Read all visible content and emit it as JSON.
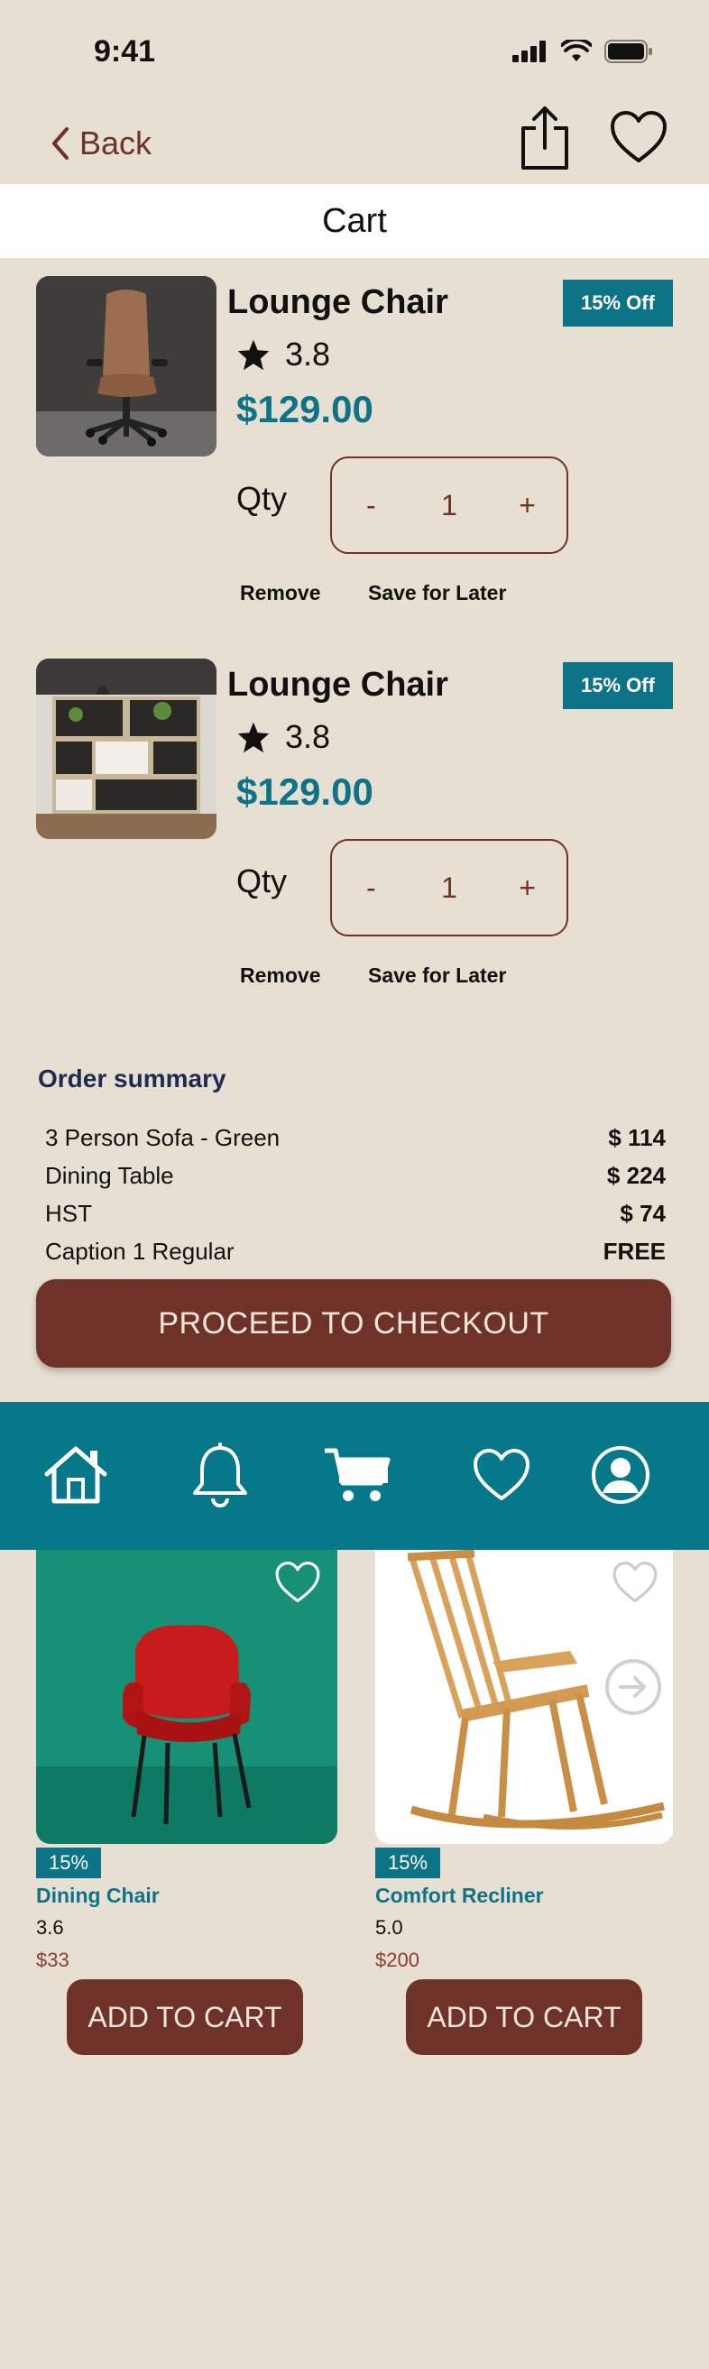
{
  "status_bar": {
    "time": "9:41"
  },
  "nav": {
    "back_label": "Back"
  },
  "header": {
    "title": "Cart"
  },
  "cart_items": [
    {
      "name": "Lounge Chair",
      "rating": "3.8",
      "price": "$129.00",
      "discount": "15% Off",
      "qty_label": "Qty",
      "qty_minus": "-",
      "qty_value": "1",
      "qty_plus": "+",
      "remove_label": "Remove",
      "save_label": "Save for Later"
    },
    {
      "name": "Lounge Chair",
      "rating": "3.8",
      "price": "$129.00",
      "discount": "15% Off",
      "qty_label": "Qty",
      "qty_minus": "-",
      "qty_value": "1",
      "qty_plus": "+",
      "remove_label": "Remove",
      "save_label": "Save for Later"
    }
  ],
  "summary": {
    "title": "Order summary",
    "rows": [
      {
        "label": "3 Person Sofa - Green",
        "value": "$ 114"
      },
      {
        "label": "Dining Table",
        "value": "$ 224"
      },
      {
        "label": "HST",
        "value": "$ 74"
      },
      {
        "label": "Caption 1 Regular",
        "value": "FREE"
      }
    ],
    "checkout_label": "PROCEED TO CHECKOUT"
  },
  "tab_bar": {
    "items": [
      {
        "icon": "home-icon"
      },
      {
        "icon": "bell-icon"
      },
      {
        "icon": "cart-icon"
      },
      {
        "icon": "heart-icon"
      },
      {
        "icon": "profile-icon"
      }
    ]
  },
  "products": [
    {
      "badge": "15%",
      "name": "Dining Chair",
      "rating": "3.6",
      "price": "$33",
      "add_label": "ADD TO CART"
    },
    {
      "badge": "15%",
      "name": "Comfort Recliner",
      "rating": "5.0",
      "price": "$200",
      "add_label": "ADD TO CART"
    }
  ],
  "colors": {
    "background": "#e8dfd3",
    "accent": "#0d7488",
    "brand": "#6e3228",
    "tab_bar": "#07778a"
  }
}
